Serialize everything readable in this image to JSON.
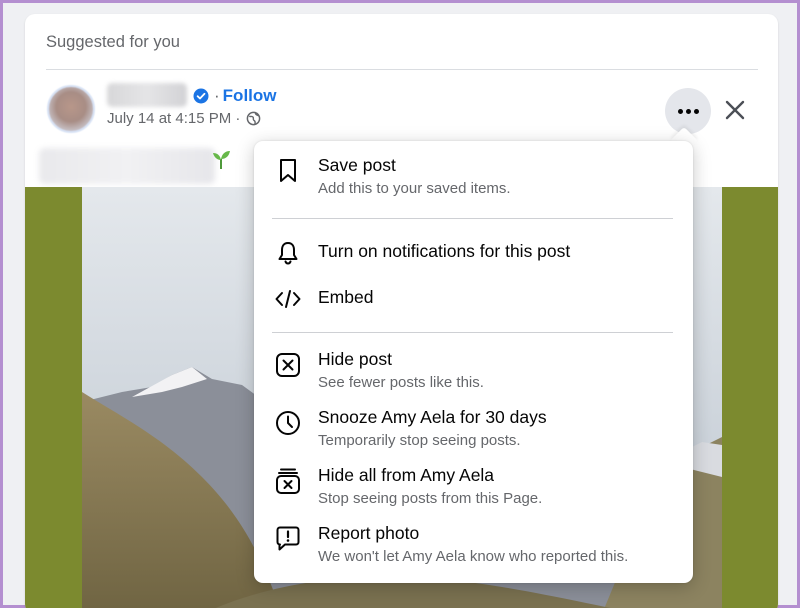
{
  "feed": {
    "suggested_label": "Suggested for you",
    "follow_separator": "·",
    "follow_label": "Follow",
    "date": "July 14 at 4:15 PM ·"
  },
  "menu": {
    "items": [
      {
        "title": "Save post",
        "subtitle": "Add this to your saved items.",
        "icon": "bookmark-icon"
      },
      {
        "title": "Turn on notifications for this post",
        "subtitle": "",
        "icon": "bell-icon"
      },
      {
        "title": "Embed",
        "subtitle": "",
        "icon": "code-icon"
      },
      {
        "title": "Hide post",
        "subtitle": "See fewer posts like this.",
        "icon": "hide-x-icon"
      },
      {
        "title": "Snooze Amy Aela for 30 days",
        "subtitle": "Temporarily stop seeing posts.",
        "icon": "clock-icon"
      },
      {
        "title": "Hide all from Amy Aela",
        "subtitle": "Stop seeing posts from this Page.",
        "icon": "hide-all-icon"
      },
      {
        "title": "Report photo",
        "subtitle": "We won't let Amy Aela know who reported this.",
        "icon": "report-icon"
      }
    ]
  },
  "colors": {
    "accent": "#1b74e4",
    "secondary_text": "#65676b",
    "photo_border": "#7c8a2f"
  }
}
